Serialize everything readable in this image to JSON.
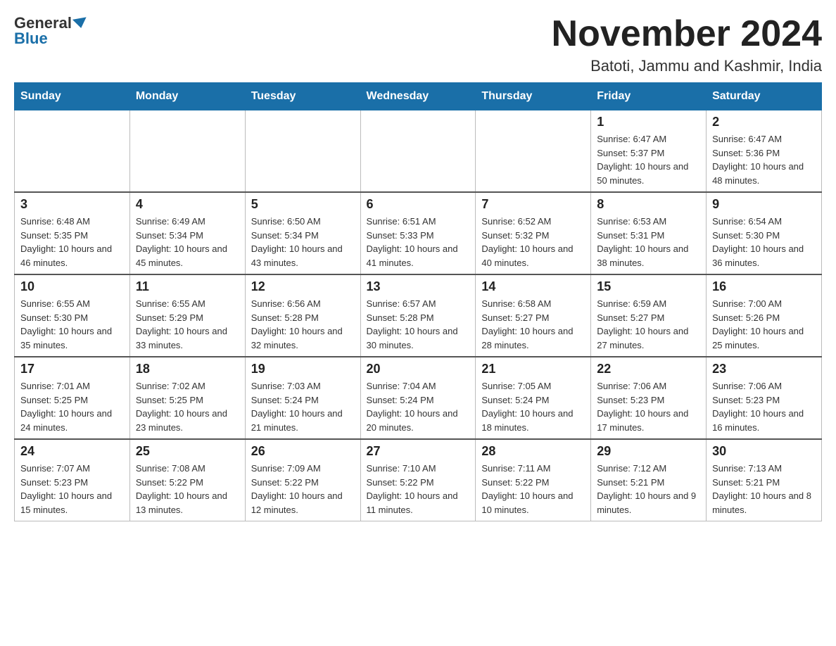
{
  "header": {
    "logo_general": "General",
    "logo_blue": "Blue",
    "main_title": "November 2024",
    "subtitle": "Batoti, Jammu and Kashmir, India"
  },
  "calendar": {
    "days_of_week": [
      "Sunday",
      "Monday",
      "Tuesday",
      "Wednesday",
      "Thursday",
      "Friday",
      "Saturday"
    ],
    "weeks": [
      [
        {
          "day": "",
          "info": ""
        },
        {
          "day": "",
          "info": ""
        },
        {
          "day": "",
          "info": ""
        },
        {
          "day": "",
          "info": ""
        },
        {
          "day": "",
          "info": ""
        },
        {
          "day": "1",
          "info": "Sunrise: 6:47 AM\nSunset: 5:37 PM\nDaylight: 10 hours and 50 minutes."
        },
        {
          "day": "2",
          "info": "Sunrise: 6:47 AM\nSunset: 5:36 PM\nDaylight: 10 hours and 48 minutes."
        }
      ],
      [
        {
          "day": "3",
          "info": "Sunrise: 6:48 AM\nSunset: 5:35 PM\nDaylight: 10 hours and 46 minutes."
        },
        {
          "day": "4",
          "info": "Sunrise: 6:49 AM\nSunset: 5:34 PM\nDaylight: 10 hours and 45 minutes."
        },
        {
          "day": "5",
          "info": "Sunrise: 6:50 AM\nSunset: 5:34 PM\nDaylight: 10 hours and 43 minutes."
        },
        {
          "day": "6",
          "info": "Sunrise: 6:51 AM\nSunset: 5:33 PM\nDaylight: 10 hours and 41 minutes."
        },
        {
          "day": "7",
          "info": "Sunrise: 6:52 AM\nSunset: 5:32 PM\nDaylight: 10 hours and 40 minutes."
        },
        {
          "day": "8",
          "info": "Sunrise: 6:53 AM\nSunset: 5:31 PM\nDaylight: 10 hours and 38 minutes."
        },
        {
          "day": "9",
          "info": "Sunrise: 6:54 AM\nSunset: 5:30 PM\nDaylight: 10 hours and 36 minutes."
        }
      ],
      [
        {
          "day": "10",
          "info": "Sunrise: 6:55 AM\nSunset: 5:30 PM\nDaylight: 10 hours and 35 minutes."
        },
        {
          "day": "11",
          "info": "Sunrise: 6:55 AM\nSunset: 5:29 PM\nDaylight: 10 hours and 33 minutes."
        },
        {
          "day": "12",
          "info": "Sunrise: 6:56 AM\nSunset: 5:28 PM\nDaylight: 10 hours and 32 minutes."
        },
        {
          "day": "13",
          "info": "Sunrise: 6:57 AM\nSunset: 5:28 PM\nDaylight: 10 hours and 30 minutes."
        },
        {
          "day": "14",
          "info": "Sunrise: 6:58 AM\nSunset: 5:27 PM\nDaylight: 10 hours and 28 minutes."
        },
        {
          "day": "15",
          "info": "Sunrise: 6:59 AM\nSunset: 5:27 PM\nDaylight: 10 hours and 27 minutes."
        },
        {
          "day": "16",
          "info": "Sunrise: 7:00 AM\nSunset: 5:26 PM\nDaylight: 10 hours and 25 minutes."
        }
      ],
      [
        {
          "day": "17",
          "info": "Sunrise: 7:01 AM\nSunset: 5:25 PM\nDaylight: 10 hours and 24 minutes."
        },
        {
          "day": "18",
          "info": "Sunrise: 7:02 AM\nSunset: 5:25 PM\nDaylight: 10 hours and 23 minutes."
        },
        {
          "day": "19",
          "info": "Sunrise: 7:03 AM\nSunset: 5:24 PM\nDaylight: 10 hours and 21 minutes."
        },
        {
          "day": "20",
          "info": "Sunrise: 7:04 AM\nSunset: 5:24 PM\nDaylight: 10 hours and 20 minutes."
        },
        {
          "day": "21",
          "info": "Sunrise: 7:05 AM\nSunset: 5:24 PM\nDaylight: 10 hours and 18 minutes."
        },
        {
          "day": "22",
          "info": "Sunrise: 7:06 AM\nSunset: 5:23 PM\nDaylight: 10 hours and 17 minutes."
        },
        {
          "day": "23",
          "info": "Sunrise: 7:06 AM\nSunset: 5:23 PM\nDaylight: 10 hours and 16 minutes."
        }
      ],
      [
        {
          "day": "24",
          "info": "Sunrise: 7:07 AM\nSunset: 5:23 PM\nDaylight: 10 hours and 15 minutes."
        },
        {
          "day": "25",
          "info": "Sunrise: 7:08 AM\nSunset: 5:22 PM\nDaylight: 10 hours and 13 minutes."
        },
        {
          "day": "26",
          "info": "Sunrise: 7:09 AM\nSunset: 5:22 PM\nDaylight: 10 hours and 12 minutes."
        },
        {
          "day": "27",
          "info": "Sunrise: 7:10 AM\nSunset: 5:22 PM\nDaylight: 10 hours and 11 minutes."
        },
        {
          "day": "28",
          "info": "Sunrise: 7:11 AM\nSunset: 5:22 PM\nDaylight: 10 hours and 10 minutes."
        },
        {
          "day": "29",
          "info": "Sunrise: 7:12 AM\nSunset: 5:21 PM\nDaylight: 10 hours and 9 minutes."
        },
        {
          "day": "30",
          "info": "Sunrise: 7:13 AM\nSunset: 5:21 PM\nDaylight: 10 hours and 8 minutes."
        }
      ]
    ]
  }
}
